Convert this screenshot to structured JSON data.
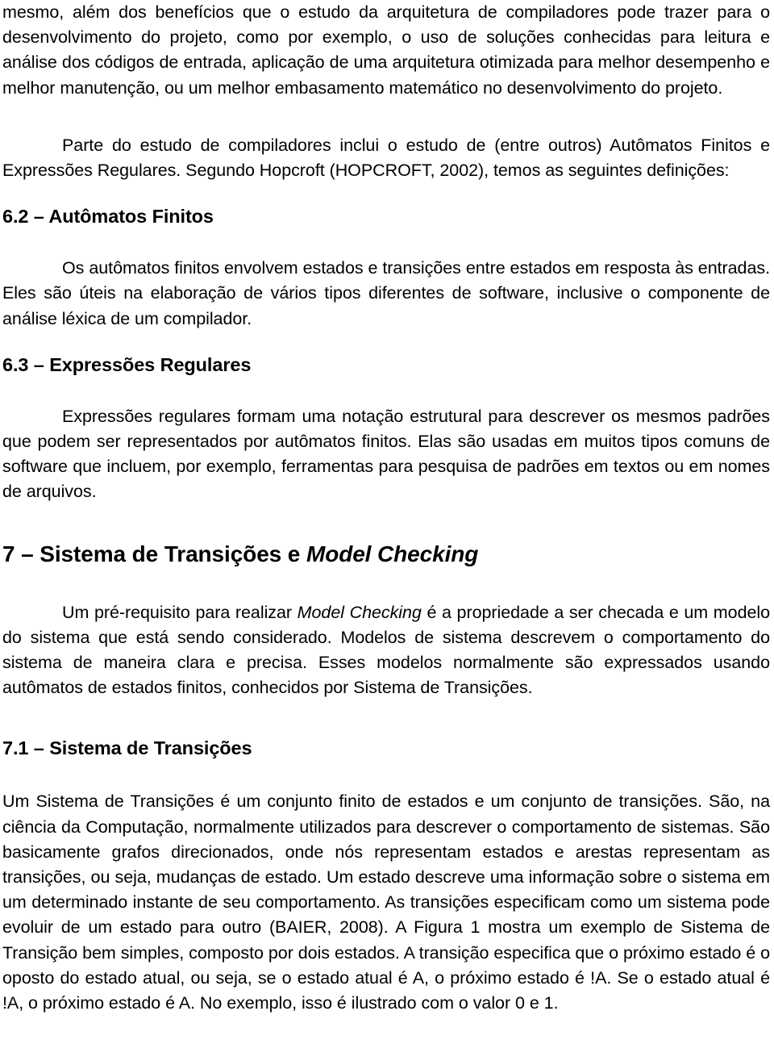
{
  "document": {
    "language": "pt-BR",
    "blocks": [
      {
        "type": "paragraph",
        "name": "paragraph-continuation-compiladores",
        "indent": false,
        "text": "mesmo, além dos benefícios que o estudo da arquitetura de compiladores pode trazer para o desenvolvimento do projeto, como por exemplo, o uso de soluções conhecidas para leitura e análise dos códigos de entrada, aplicação de uma arquitetura otimizada para melhor desempenho e melhor manutenção, ou um melhor embasamento matemático no desenvolvimento do projeto."
      },
      {
        "type": "paragraph",
        "name": "paragraph-parte-do-estudo",
        "indent": true,
        "text": "Parte do estudo de compiladores inclui o estudo de (entre outros) Autômatos Finitos e Expressões Regulares. Segundo Hopcroft (HOPCROFT, 2002), temos as seguintes definições:"
      },
      {
        "type": "heading2",
        "name": "heading-6-2-automatos-finitos",
        "text": "6.2 – Autômatos Finitos"
      },
      {
        "type": "paragraph",
        "name": "paragraph-os-automatos-finitos",
        "indent": true,
        "text": "Os autômatos finitos envolvem estados e transições entre estados em resposta às entradas. Eles são úteis na elaboração de vários tipos diferentes de software, inclusive o componente de análise léxica de um compilador."
      },
      {
        "type": "heading2",
        "name": "heading-6-3-expressoes-regulares",
        "text": "6.3 – Expressões Regulares"
      },
      {
        "type": "paragraph",
        "name": "paragraph-expressoes-regulares",
        "indent": true,
        "text": "Expressões regulares formam uma notação estrutural para descrever os mesmos padrões que podem ser representados por autômatos finitos. Elas são usadas em muitos tipos comuns de software que incluem, por exemplo, ferramentas para pesquisa de padrões em textos ou em nomes de arquivos."
      },
      {
        "type": "heading1",
        "name": "heading-7-sistema-de-transicoes-e-model-checking",
        "text_plain": "7 – Sistema de Transições e ",
        "text_italic": "Model Checking"
      },
      {
        "type": "paragraph",
        "name": "paragraph-um-pre-requisito",
        "indent": true,
        "text_part1": "Um pré-requisito para realizar ",
        "text_italic": "Model Checking",
        "text_part2": " é a propriedade a ser checada e um modelo do sistema que está sendo considerado. Modelos de sistema descrevem o comportamento do sistema de maneira clara e precisa. Esses modelos normalmente são expressados usando autômatos de estados finitos, conhecidos por Sistema de Transições."
      },
      {
        "type": "heading2",
        "name": "heading-7-1-sistema-de-transicoes",
        "text": "7.1 – Sistema de Transições"
      },
      {
        "type": "paragraph",
        "name": "paragraph-um-sistema-de-transicoes",
        "indent": false,
        "text": "Um Sistema de Transições é um conjunto finito de estados e um conjunto de transições. São, na ciência da Computação, normalmente utilizados para descrever o comportamento de sistemas. São basicamente grafos direcionados, onde nós representam estados e arestas representam as transições, ou seja, mudanças de estado. Um estado descreve uma informação sobre o sistema em um determinado instante de seu comportamento. As transições especificam como um sistema pode evoluir de um estado para outro (BAIER, 2008). A Figura 1 mostra um exemplo de Sistema de Transição bem simples, composto por dois estados. A transição especifica que o próximo estado é o oposto do estado atual, ou seja, se o estado atual é A, o próximo estado é !A. Se o estado atual é !A, o próximo estado é A. No exemplo, isso é ilustrado com o valor 0 e 1."
      }
    ]
  }
}
